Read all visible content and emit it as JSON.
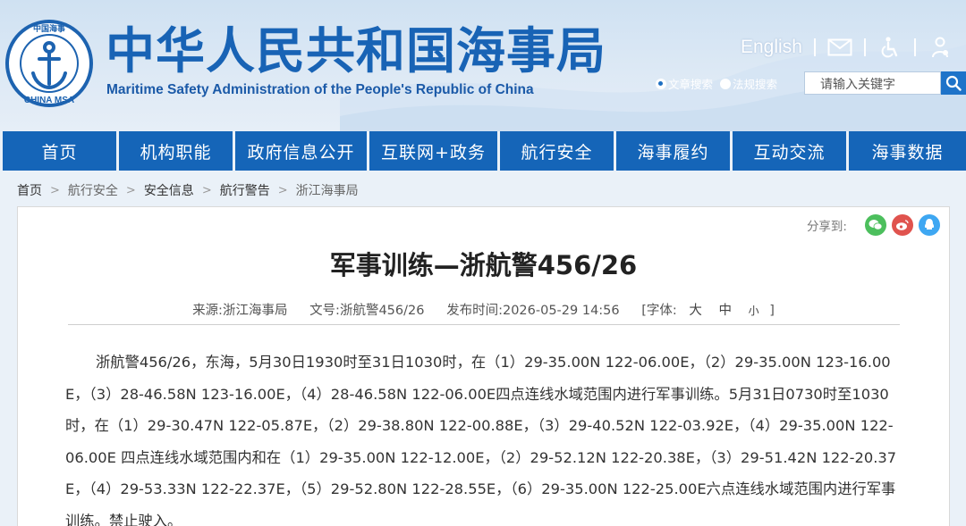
{
  "header": {
    "title": "中华人民共和国海事局",
    "subtitle": "Maritime Safety Administration of the People's Republic of China",
    "logo_text": "CHINA MSA",
    "logo_inner_text": "中国海事",
    "brand_color": "#1863b5",
    "toplinks": {
      "english_label": "English",
      "icons": [
        "mail-icon",
        "accessibility-icon",
        "elder-mode-icon"
      ]
    },
    "search": {
      "options": [
        {
          "label": "文章搜索",
          "checked": true
        },
        {
          "label": "法规搜索",
          "checked": false
        }
      ],
      "placeholder": "请输入关键字",
      "button_icon": "search-icon"
    }
  },
  "nav": {
    "color": "#1565b8",
    "items": [
      "首页",
      "机构职能",
      "政府信息公开",
      "互联网+政务",
      "航行安全",
      "海事履约",
      "互动交流",
      "海事数据"
    ]
  },
  "breadcrumb": [
    "首页",
    "航行安全",
    "安全信息",
    "航行警告",
    "浙江海事局"
  ],
  "article": {
    "share_label": "分享到:",
    "share_icons": [
      {
        "name": "wechat-icon",
        "color": "#4cbf5d"
      },
      {
        "name": "weibo-icon",
        "color": "#e0534e"
      },
      {
        "name": "qq-icon",
        "color": "#3ea7f2"
      }
    ],
    "title": "军事训练—浙航警456/26",
    "source": "来源:浙江海事局",
    "doc_no": "文号:浙航警456/26",
    "publish_time": "发布时间:2026-05-29 14:56",
    "font_size_label": "[字体:",
    "font_sizes": [
      "大",
      "中",
      "小"
    ],
    "font_size_close": "]",
    "body": "浙航警456/26，东海，5月30日1930时至31日1030时，在（1）29-35.00N 122-06.00E，（2）29-35.00N 123-16.00E，（3）28-46.58N 123-16.00E，（4）28-46.58N 122-06.00E四点连线水域范围内进行军事训练。5月31日0730时至1030时，在（1）29-30.47N 122-05.87E，（2）29-38.80N 122-00.88E，（3）29-40.52N 122-03.92E，（4）29-35.00N 122-06.00E 四点连线水域范围内和在（1）29-35.00N 122-12.00E，（2）29-52.12N 122-20.38E，（3）29-51.42N 122-20.37E，（4）29-53.33N 122-22.37E，（5）29-52.80N 122-28.55E，（6）29-35.00N 122-25.00E六点连线水域范围内进行军事训练。禁止驶入。"
  }
}
